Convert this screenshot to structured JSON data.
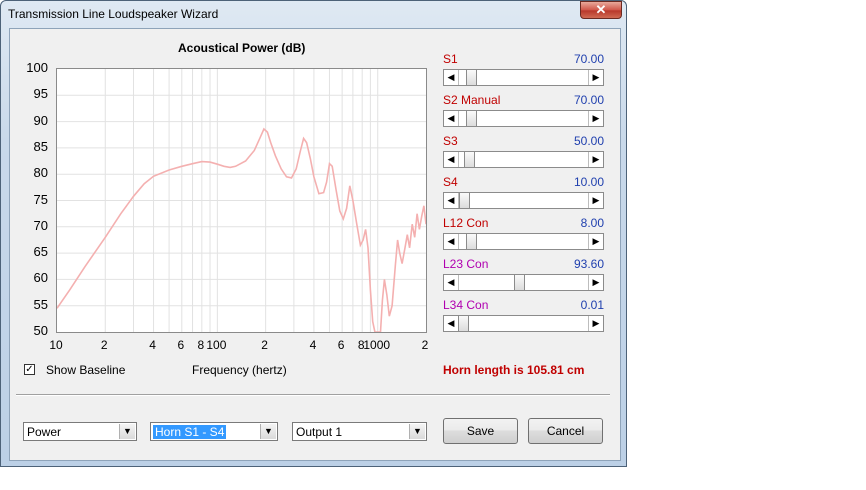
{
  "window": {
    "title": "Transmission Line Loudspeaker Wizard",
    "close_glyph": "✕"
  },
  "chart_data": {
    "type": "line",
    "title": "Acoustical Power (dB)",
    "xlabel": "Frequency (hertz)",
    "ylabel": "",
    "xscale": "log",
    "xlim": [
      10,
      2000
    ],
    "ylim": [
      50,
      100
    ],
    "y_ticks": [
      "100",
      "95",
      "90",
      "85",
      "80",
      "75",
      "70",
      "65",
      "60",
      "55",
      "50"
    ],
    "x_tick_labels": [
      {
        "x": 10,
        "label": "10"
      },
      {
        "x": 20,
        "label": "2"
      },
      {
        "x": 40,
        "label": "4"
      },
      {
        "x": 60,
        "label": "6"
      },
      {
        "x": 80,
        "label": "8"
      },
      {
        "x": 100,
        "label": "100"
      },
      {
        "x": 200,
        "label": "2"
      },
      {
        "x": 400,
        "label": "4"
      },
      {
        "x": 600,
        "label": "6"
      },
      {
        "x": 800,
        "label": "8"
      },
      {
        "x": 1000,
        "label": "1000"
      },
      {
        "x": 2000,
        "label": "2"
      }
    ],
    "grid": true,
    "line_color": "#f4b0b0",
    "series": [
      {
        "points": [
          [
            10,
            54.5
          ],
          [
            12,
            58
          ],
          [
            15,
            62.5
          ],
          [
            20,
            68
          ],
          [
            25,
            72.5
          ],
          [
            30,
            75.8
          ],
          [
            35,
            78.2
          ],
          [
            40,
            79.6
          ],
          [
            50,
            80.8
          ],
          [
            60,
            81.5
          ],
          [
            70,
            82
          ],
          [
            80,
            82.4
          ],
          [
            90,
            82.3
          ],
          [
            100,
            81.9
          ],
          [
            110,
            81.5
          ],
          [
            120,
            81.3
          ],
          [
            130,
            81.5
          ],
          [
            150,
            82.5
          ],
          [
            170,
            84.5
          ],
          [
            185,
            87
          ],
          [
            195,
            88.6
          ],
          [
            205,
            88
          ],
          [
            215,
            86
          ],
          [
            230,
            83.5
          ],
          [
            250,
            81
          ],
          [
            270,
            79.5
          ],
          [
            290,
            79.3
          ],
          [
            310,
            81
          ],
          [
            330,
            84.5
          ],
          [
            345,
            86.8
          ],
          [
            360,
            86
          ],
          [
            380,
            83
          ],
          [
            400,
            79.5
          ],
          [
            430,
            76.3
          ],
          [
            460,
            76.5
          ],
          [
            480,
            78.5
          ],
          [
            500,
            82
          ],
          [
            520,
            81.5
          ],
          [
            550,
            77
          ],
          [
            580,
            73
          ],
          [
            610,
            71.5
          ],
          [
            640,
            73.5
          ],
          [
            670,
            77.8
          ],
          [
            700,
            75
          ],
          [
            740,
            70.5
          ],
          [
            780,
            66.5
          ],
          [
            810,
            67.5
          ],
          [
            840,
            69.5
          ],
          [
            870,
            66
          ],
          [
            900,
            58
          ],
          [
            930,
            52
          ],
          [
            960,
            50
          ],
          [
            1010,
            50
          ],
          [
            1040,
            50
          ],
          [
            1070,
            56
          ],
          [
            1100,
            60
          ],
          [
            1140,
            57
          ],
          [
            1180,
            53
          ],
          [
            1230,
            55
          ],
          [
            1290,
            63
          ],
          [
            1330,
            67.5
          ],
          [
            1370,
            65
          ],
          [
            1420,
            63
          ],
          [
            1480,
            66
          ],
          [
            1530,
            68.5
          ],
          [
            1580,
            66
          ],
          [
            1640,
            70.5
          ],
          [
            1700,
            68
          ],
          [
            1760,
            72.5
          ],
          [
            1820,
            69.5
          ],
          [
            1880,
            72
          ],
          [
            1940,
            74
          ],
          [
            2000,
            70.5
          ]
        ]
      }
    ]
  },
  "controls": {
    "show_baseline": {
      "label": "Show Baseline",
      "checked": true,
      "check_glyph": "✓"
    },
    "sliders": [
      {
        "label": "S1",
        "value": "70.00",
        "color": "#c00000",
        "position": 0.07
      },
      {
        "label": "S2  Manual",
        "value": "70.00",
        "color": "#c00000",
        "position": 0.07
      },
      {
        "label": "S3",
        "value": "50.00",
        "color": "#c00000",
        "position": 0.05
      },
      {
        "label": "S4",
        "value": "10.00",
        "color": "#c00000",
        "position": 0.01
      },
      {
        "label": "L12  Con",
        "value": "8.00",
        "color": "#c00000",
        "position": 0.07
      },
      {
        "label": "L23  Con",
        "value": "93.60",
        "color": "#b000b0",
        "position": 0.47
      },
      {
        "label": "L34  Con",
        "value": "0.01",
        "color": "#b000b0",
        "position": 0.0
      }
    ],
    "horn_length": "Horn length is 105.81 cm",
    "arrow_left": "◀",
    "arrow_right": "▶"
  },
  "footer": {
    "combo_mode": "Power",
    "combo_range": "Horn S1 - S4",
    "combo_output": "Output 1",
    "dropdown_glyph": "▼",
    "save_label": "Save",
    "cancel_label": "Cancel"
  }
}
